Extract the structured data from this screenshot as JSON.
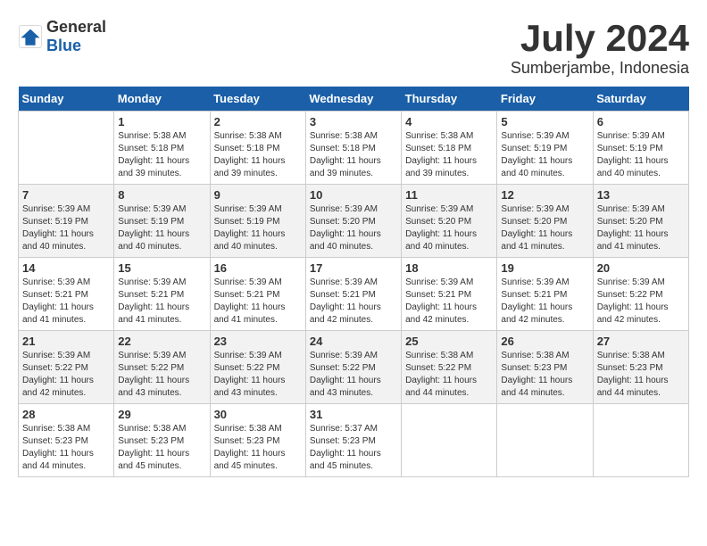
{
  "header": {
    "logo_general": "General",
    "logo_blue": "Blue",
    "month_year": "July 2024",
    "location": "Sumberjambe, Indonesia"
  },
  "weekdays": [
    "Sunday",
    "Monday",
    "Tuesday",
    "Wednesday",
    "Thursday",
    "Friday",
    "Saturday"
  ],
  "weeks": [
    [
      {
        "day": "",
        "info": ""
      },
      {
        "day": "1",
        "info": "Sunrise: 5:38 AM\nSunset: 5:18 PM\nDaylight: 11 hours\nand 39 minutes."
      },
      {
        "day": "2",
        "info": "Sunrise: 5:38 AM\nSunset: 5:18 PM\nDaylight: 11 hours\nand 39 minutes."
      },
      {
        "day": "3",
        "info": "Sunrise: 5:38 AM\nSunset: 5:18 PM\nDaylight: 11 hours\nand 39 minutes."
      },
      {
        "day": "4",
        "info": "Sunrise: 5:38 AM\nSunset: 5:18 PM\nDaylight: 11 hours\nand 39 minutes."
      },
      {
        "day": "5",
        "info": "Sunrise: 5:39 AM\nSunset: 5:19 PM\nDaylight: 11 hours\nand 40 minutes."
      },
      {
        "day": "6",
        "info": "Sunrise: 5:39 AM\nSunset: 5:19 PM\nDaylight: 11 hours\nand 40 minutes."
      }
    ],
    [
      {
        "day": "7",
        "info": "Sunrise: 5:39 AM\nSunset: 5:19 PM\nDaylight: 11 hours\nand 40 minutes."
      },
      {
        "day": "8",
        "info": "Sunrise: 5:39 AM\nSunset: 5:19 PM\nDaylight: 11 hours\nand 40 minutes."
      },
      {
        "day": "9",
        "info": "Sunrise: 5:39 AM\nSunset: 5:19 PM\nDaylight: 11 hours\nand 40 minutes."
      },
      {
        "day": "10",
        "info": "Sunrise: 5:39 AM\nSunset: 5:20 PM\nDaylight: 11 hours\nand 40 minutes."
      },
      {
        "day": "11",
        "info": "Sunrise: 5:39 AM\nSunset: 5:20 PM\nDaylight: 11 hours\nand 40 minutes."
      },
      {
        "day": "12",
        "info": "Sunrise: 5:39 AM\nSunset: 5:20 PM\nDaylight: 11 hours\nand 41 minutes."
      },
      {
        "day": "13",
        "info": "Sunrise: 5:39 AM\nSunset: 5:20 PM\nDaylight: 11 hours\nand 41 minutes."
      }
    ],
    [
      {
        "day": "14",
        "info": "Sunrise: 5:39 AM\nSunset: 5:21 PM\nDaylight: 11 hours\nand 41 minutes."
      },
      {
        "day": "15",
        "info": "Sunrise: 5:39 AM\nSunset: 5:21 PM\nDaylight: 11 hours\nand 41 minutes."
      },
      {
        "day": "16",
        "info": "Sunrise: 5:39 AM\nSunset: 5:21 PM\nDaylight: 11 hours\nand 41 minutes."
      },
      {
        "day": "17",
        "info": "Sunrise: 5:39 AM\nSunset: 5:21 PM\nDaylight: 11 hours\nand 42 minutes."
      },
      {
        "day": "18",
        "info": "Sunrise: 5:39 AM\nSunset: 5:21 PM\nDaylight: 11 hours\nand 42 minutes."
      },
      {
        "day": "19",
        "info": "Sunrise: 5:39 AM\nSunset: 5:21 PM\nDaylight: 11 hours\nand 42 minutes."
      },
      {
        "day": "20",
        "info": "Sunrise: 5:39 AM\nSunset: 5:22 PM\nDaylight: 11 hours\nand 42 minutes."
      }
    ],
    [
      {
        "day": "21",
        "info": "Sunrise: 5:39 AM\nSunset: 5:22 PM\nDaylight: 11 hours\nand 42 minutes."
      },
      {
        "day": "22",
        "info": "Sunrise: 5:39 AM\nSunset: 5:22 PM\nDaylight: 11 hours\nand 43 minutes."
      },
      {
        "day": "23",
        "info": "Sunrise: 5:39 AM\nSunset: 5:22 PM\nDaylight: 11 hours\nand 43 minutes."
      },
      {
        "day": "24",
        "info": "Sunrise: 5:39 AM\nSunset: 5:22 PM\nDaylight: 11 hours\nand 43 minutes."
      },
      {
        "day": "25",
        "info": "Sunrise: 5:38 AM\nSunset: 5:22 PM\nDaylight: 11 hours\nand 44 minutes."
      },
      {
        "day": "26",
        "info": "Sunrise: 5:38 AM\nSunset: 5:23 PM\nDaylight: 11 hours\nand 44 minutes."
      },
      {
        "day": "27",
        "info": "Sunrise: 5:38 AM\nSunset: 5:23 PM\nDaylight: 11 hours\nand 44 minutes."
      }
    ],
    [
      {
        "day": "28",
        "info": "Sunrise: 5:38 AM\nSunset: 5:23 PM\nDaylight: 11 hours\nand 44 minutes."
      },
      {
        "day": "29",
        "info": "Sunrise: 5:38 AM\nSunset: 5:23 PM\nDaylight: 11 hours\nand 45 minutes."
      },
      {
        "day": "30",
        "info": "Sunrise: 5:38 AM\nSunset: 5:23 PM\nDaylight: 11 hours\nand 45 minutes."
      },
      {
        "day": "31",
        "info": "Sunrise: 5:37 AM\nSunset: 5:23 PM\nDaylight: 11 hours\nand 45 minutes."
      },
      {
        "day": "",
        "info": ""
      },
      {
        "day": "",
        "info": ""
      },
      {
        "day": "",
        "info": ""
      }
    ]
  ]
}
